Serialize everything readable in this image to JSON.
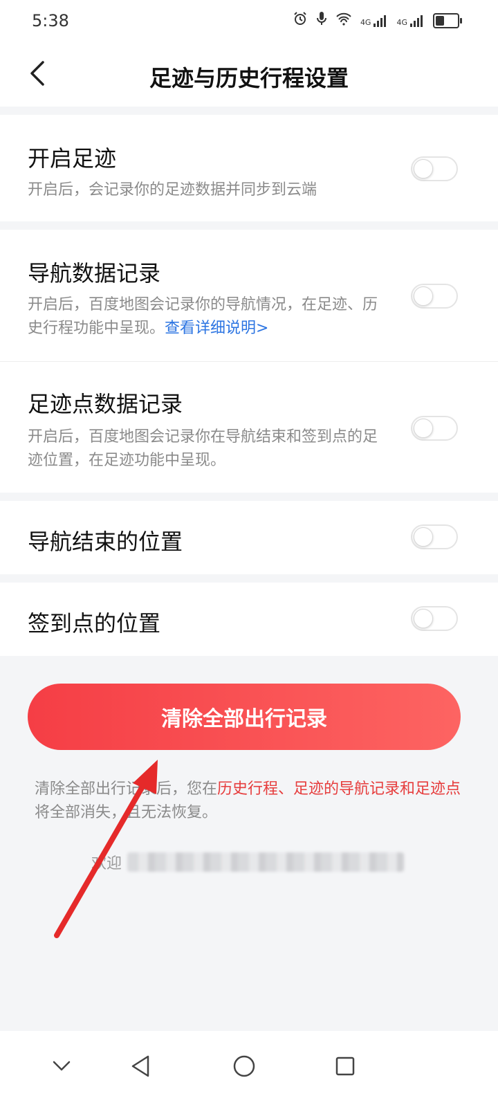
{
  "status_bar": {
    "time": "5:38",
    "signal1": "4G",
    "signal2": "4G",
    "battery_level": 0.45
  },
  "header": {
    "title": "足迹与历史行程设置",
    "back_icon": "chevron-left-icon"
  },
  "settings": [
    {
      "title": "开启足迹",
      "desc": "开启后，会记录你的足迹数据并同步到云端",
      "enabled": false
    },
    {
      "title": "导航数据记录",
      "desc": "开启后，百度地图会记录你的导航情况，在足迹、历史行程功能中呈现。",
      "link": "查看详细说明>",
      "enabled": false
    },
    {
      "title": "足迹点数据记录",
      "desc": "开启后，百度地图会记录你在导航结束和签到点的足迹位置，在足迹功能中呈现。",
      "enabled": false
    },
    {
      "title": "导航结束的位置",
      "enabled": false
    },
    {
      "title": "签到点的位置",
      "enabled": false
    }
  ],
  "clear_button": {
    "label": "清除全部出行记录",
    "gradient_start": "#f53e45",
    "gradient_end": "#fd6462"
  },
  "notice": {
    "part1": "清除全部出行记录后，您在",
    "highlight1": "历史行程、足迹的导航记录和足迹点",
    "part2": "将全部消失，且无法恢复。",
    "highlight_color": "#e63c3c"
  },
  "welcome": {
    "prefix": "欢迎"
  },
  "colors": {
    "link": "#2b74e2",
    "background": "#f4f5f7",
    "annotation_arrow": "#e52a2a"
  },
  "navbar": {
    "icons": [
      "chevron-down-icon",
      "back-triangle-icon",
      "home-circle-icon",
      "recents-square-icon"
    ]
  }
}
